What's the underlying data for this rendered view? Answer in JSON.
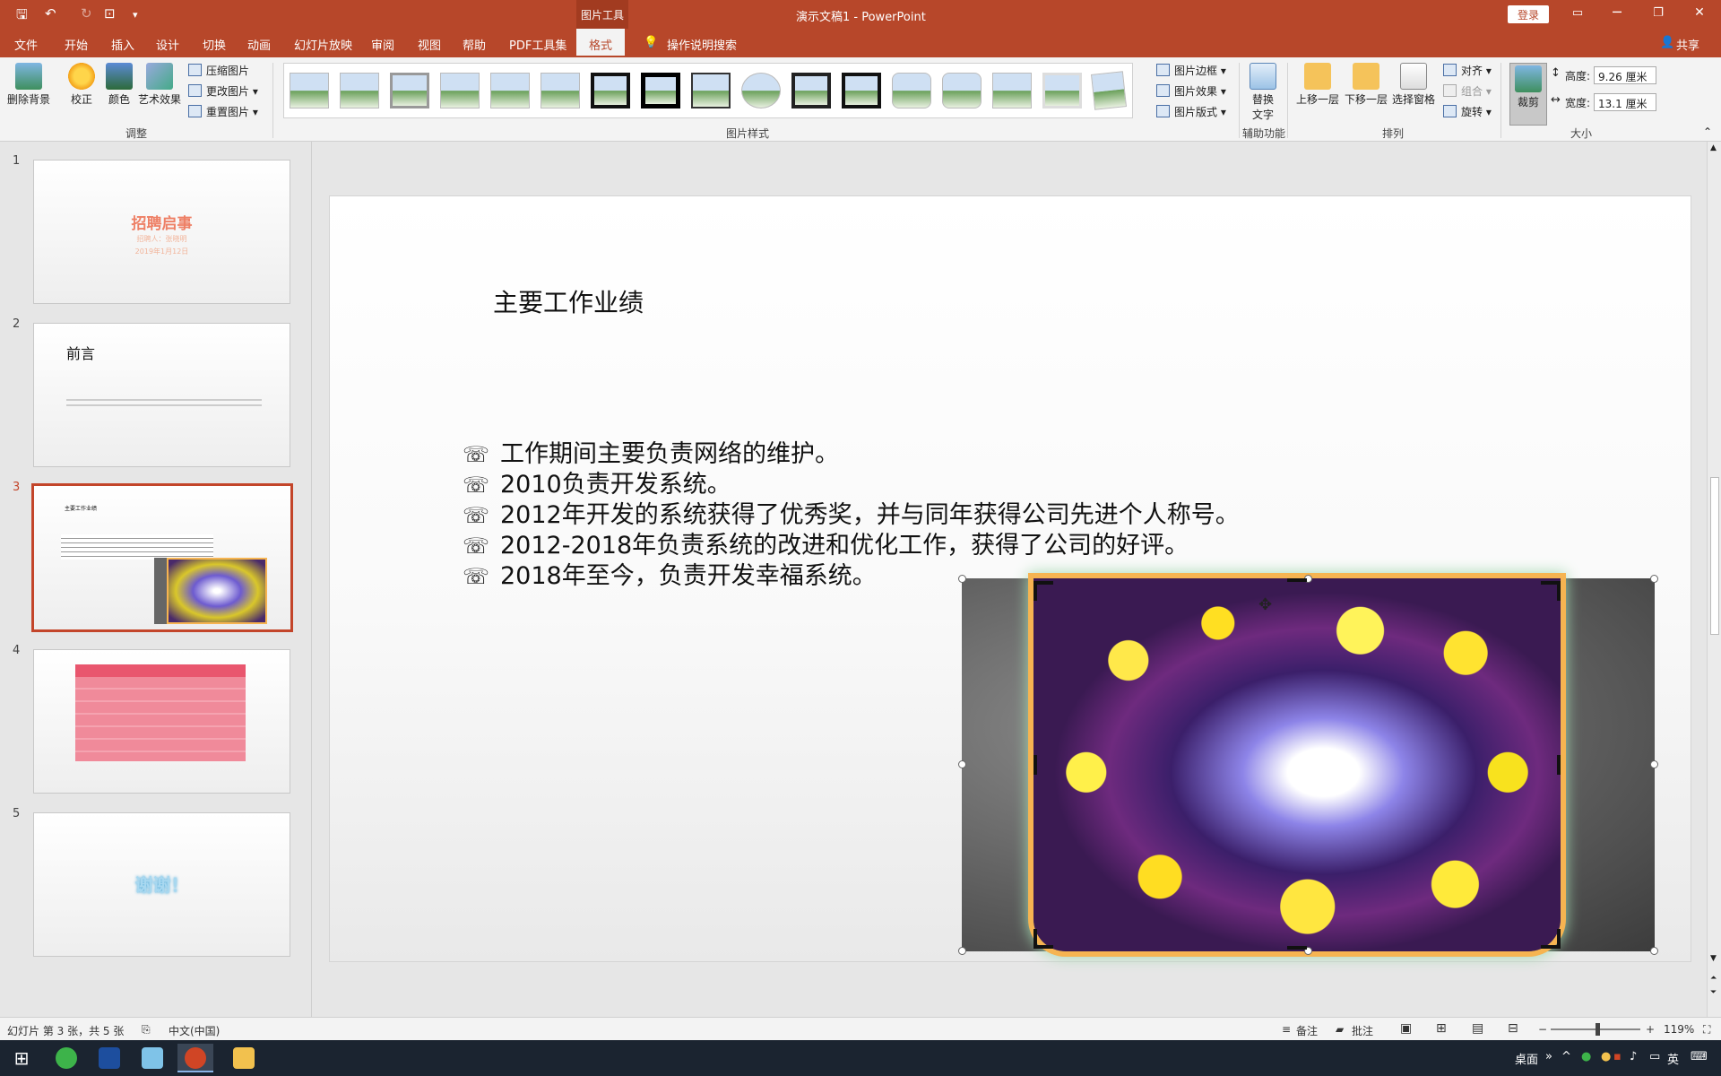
{
  "titlebar": {
    "context_tab": "图片工具",
    "doc_title": "演示文稿1 - PowerPoint",
    "login_label": "登录",
    "minimize": "─",
    "restore": "❐",
    "close": "✕"
  },
  "tabs": [
    {
      "label": "文件"
    },
    {
      "label": "开始"
    },
    {
      "label": "插入"
    },
    {
      "label": "设计"
    },
    {
      "label": "切换"
    },
    {
      "label": "动画"
    },
    {
      "label": "幻灯片放映"
    },
    {
      "label": "审阅"
    },
    {
      "label": "视图"
    },
    {
      "label": "帮助"
    },
    {
      "label": "PDF工具集"
    },
    {
      "label": "格式"
    }
  ],
  "search_hint": "操作说明搜索",
  "share_label": "共享",
  "ribbon": {
    "remove_bg": "删除背景",
    "corrections": "校正",
    "color": "颜色",
    "artistic": "艺术效果",
    "compress": "压缩图片",
    "change_pic": "更改图片",
    "reset_pic": "重置图片",
    "group_adjust": "调整",
    "group_styles": "图片样式",
    "pic_border": "图片边框",
    "pic_effects": "图片效果",
    "pic_layout": "图片版式",
    "alt_text_1": "替换",
    "alt_text_2": "文字",
    "group_access": "辅助功能",
    "bring_forward": "上移一层",
    "send_backward": "下移一层",
    "selection_pane": "选择窗格",
    "align": "对齐",
    "group": "组合",
    "rotate": "旋转",
    "group_arrange": "排列",
    "crop": "裁剪",
    "height_label": "高度:",
    "height_value": "9.26 厘米",
    "width_label": "宽度:",
    "width_value": "13.1 厘米",
    "group_size": "大小"
  },
  "thumbnails": [
    {
      "num": "1",
      "title": "招聘启事",
      "sub1": "招聘人：张晓明",
      "sub2": "2019年1月12日"
    },
    {
      "num": "2",
      "title": "前言"
    },
    {
      "num": "3",
      "title": "主要工作业绩"
    },
    {
      "num": "4",
      "title": ""
    },
    {
      "num": "5",
      "title": "谢谢！"
    }
  ],
  "slide": {
    "title": "主要工作业绩",
    "bullet_icon": "☏",
    "bullets": [
      "工作期间主要负责网络的维护。",
      "2010负责开发系统。",
      "2012年开发的系统获得了优秀奖，并与同年获得公司先进个人称号。",
      "2012-2018年负责系统的改进和优化工作，获得了公司的好评。",
      "2018年至今，负责开发幸福系统。"
    ]
  },
  "status": {
    "slide_info": "幻灯片 第 3 张，共 5 张",
    "language": "中文(中国)",
    "notes": "备注",
    "comments": "批注",
    "zoom": "119%"
  },
  "taskbar": {
    "desktop": "桌面",
    "ime": "英"
  },
  "colors": {
    "accent": "#b7472a",
    "selected_border": "#c3452a"
  }
}
